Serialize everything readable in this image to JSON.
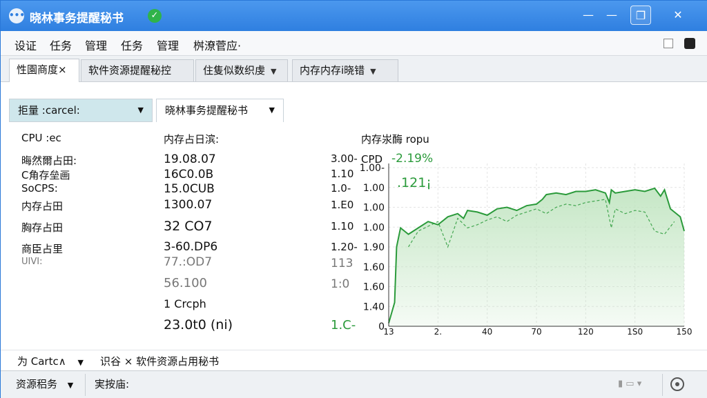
{
  "window": {
    "title": "晓林事务提醒秘书",
    "controls": {
      "minimize": "—",
      "maximize": "—",
      "restore": "❐",
      "close": "✕"
    }
  },
  "menubar": {
    "items": [
      "设证",
      "任务",
      "管理",
      "任务",
      "管理",
      "桝潦菅应·"
    ]
  },
  "tabs": [
    {
      "label": "性園商度×",
      "active": true
    },
    {
      "label": "软件资源提醒秘控",
      "active": false
    },
    {
      "label": "住隻似数织虔",
      "active": false
    },
    {
      "label": "内存内存i晓错",
      "active": false
    }
  ],
  "subtabs": {
    "filter_label": "拒量 :carcel:",
    "assistant_label": "晓林事务提醒秘书"
  },
  "left_panel": {
    "labels": [
      "CPU :ec",
      "晦然爾占田:",
      "C角存垒画",
      "SoCPS:",
      "内存占田",
      "胸存占田",
      "商臣占里",
      "UIVI:"
    ]
  },
  "middle_panel": {
    "title": "内存占日滨:",
    "values": [
      "19.08.07",
      "16C0.0B",
      "15.0CUB",
      "1300.07",
      "32 CO7",
      "3-60.DP6",
      "77.:OD7",
      "56.100",
      "1 Crcph",
      "23.0t0 (ni)"
    ],
    "side_numbers": [
      "3.00-",
      "1.10",
      "1.0-",
      "1.E0",
      "1.10",
      "1.20-",
      "113",
      "1:0",
      "1.C-"
    ]
  },
  "chart_panel": {
    "title": "内存汖酶 ropu",
    "cpu_label": "CPD",
    "cpu_value": "-2.19%",
    "secondary_value": ".121¡"
  },
  "chart_data": {
    "type": "area",
    "title": "内存汖酶 ropu",
    "xlabel": "",
    "ylabel": "",
    "y_ticks": [
      "1.00-",
      "1.00",
      "1.00",
      "1.00",
      "1.90",
      "1.60",
      "1.60",
      "1.40",
      "0"
    ],
    "x_ticks": [
      "13",
      "2.",
      "40",
      "70",
      "120",
      "1S0",
      "150"
    ],
    "x_range": [
      0,
      150
    ],
    "y_range": [
      0,
      1
    ],
    "series": [
      {
        "x": [
          0,
          3,
          4,
          6,
          10,
          15,
          20,
          25,
          30,
          35,
          38,
          40,
          45,
          50,
          55,
          60,
          65,
          70,
          75,
          78,
          80,
          85,
          90,
          95,
          100,
          105,
          110,
          112,
          113,
          115,
          120,
          125,
          130,
          135,
          138,
          140,
          143,
          145,
          148,
          150
        ],
        "values": [
          0.02,
          0.15,
          0.5,
          0.62,
          0.58,
          0.62,
          0.66,
          0.64,
          0.69,
          0.71,
          0.68,
          0.73,
          0.72,
          0.7,
          0.74,
          0.75,
          0.73,
          0.76,
          0.77,
          0.8,
          0.83,
          0.84,
          0.83,
          0.85,
          0.85,
          0.86,
          0.84,
          0.78,
          0.86,
          0.84,
          0.85,
          0.86,
          0.85,
          0.87,
          0.82,
          0.86,
          0.74,
          0.72,
          0.69,
          0.6
        ]
      },
      {
        "x": [
          10,
          15,
          20,
          25,
          30,
          35,
          40,
          45,
          50,
          55,
          60,
          65,
          70,
          75,
          80,
          85,
          90,
          95,
          100,
          105,
          110,
          113,
          115,
          120,
          125,
          130,
          135,
          140,
          145
        ],
        "values": [
          0.5,
          0.6,
          0.63,
          0.66,
          0.5,
          0.68,
          0.62,
          0.64,
          0.67,
          0.69,
          0.66,
          0.7,
          0.72,
          0.74,
          0.71,
          0.75,
          0.77,
          0.76,
          0.78,
          0.79,
          0.8,
          0.62,
          0.74,
          0.71,
          0.73,
          0.72,
          0.6,
          0.58,
          0.66
        ]
      }
    ],
    "colors": {
      "line": "#2a9a3a",
      "fill": "#bfe4bf"
    },
    "grid": true
  },
  "bottom_tabs": {
    "left_label": "为 Cartc∧",
    "right_label": "识谷 × 软件资源占用秘书"
  },
  "statusbar": {
    "left": "资源稆务",
    "mid": "実按庙:",
    "right_controls": "▮ ▭ ▾"
  },
  "icons": [
    "app-icon",
    "verified-icon",
    "gear-icon",
    "chevron-down-icon",
    "close-icon"
  ],
  "colors": {
    "titlebar": "#2f7fe0",
    "accent_green": "#2a9a3a",
    "filter_bg": "#cfe7ec"
  }
}
